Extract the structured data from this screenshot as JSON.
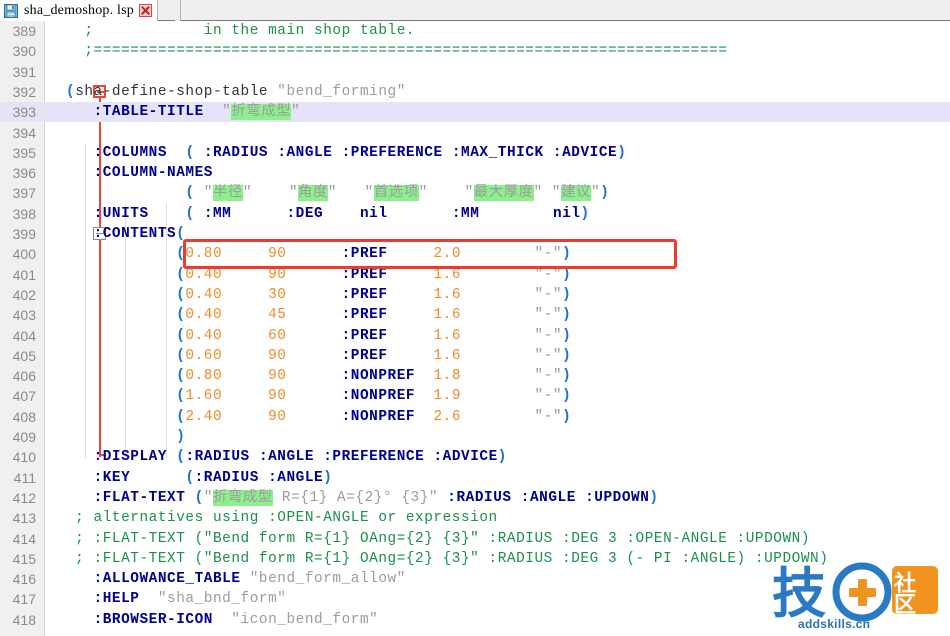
{
  "window": {
    "tab": {
      "title": "sha_demoshop. lsp",
      "save_icon": "floppy-save-icon",
      "close_icon": "close-icon"
    }
  },
  "editor": {
    "first_line_number": 389,
    "colors": {
      "keyword": "#00008f",
      "paren": "#1f6fd0",
      "number": "#f08b2a",
      "string": "#9c9c9c",
      "comment": "#1a8f4e",
      "current_line_bg": "#e6e3f7",
      "selection_bg": "#8cf08c",
      "annotation": "#ee3b2b",
      "gutter_bg": "#f0f0f0"
    },
    "lines": [
      {
        "n": 389,
        "text": "  ;            in the main shop table."
      },
      {
        "n": 390,
        "text": "  ;====================================================================="
      },
      {
        "n": 391,
        "text": ""
      },
      {
        "n": 392,
        "text": "(sha-define-shop-table \"bend_forming\""
      },
      {
        "n": 393,
        "text": "   :TABLE-TITLE  \"折弯成型\""
      },
      {
        "n": 394,
        "text": ""
      },
      {
        "n": 395,
        "text": "   :COLUMNS  ( :RADIUS :ANGLE :PREFERENCE :MAX_THICK :ADVICE)"
      },
      {
        "n": 396,
        "text": "   :COLUMN-NAMES"
      },
      {
        "n": 397,
        "text": "             ( \"半径\"    \"角度\"   \"首选项\"    \"最大厚度\" \"建议\")"
      },
      {
        "n": 398,
        "text": "   :UNITS    ( :MM      :DEG    nil       :MM        nil)"
      },
      {
        "n": 399,
        "text": "   :CONTENTS("
      },
      {
        "n": 400,
        "text": "            (0.80     90      :PREF     2.0        \"-\")"
      },
      {
        "n": 401,
        "text": "            (0.40     90      :PREF     1.6        \"-\")"
      },
      {
        "n": 402,
        "text": "            (0.40     30      :PREF     1.6        \"-\")"
      },
      {
        "n": 403,
        "text": "            (0.40     45      :PREF     1.6        \"-\")"
      },
      {
        "n": 404,
        "text": "            (0.40     60      :PREF     1.6        \"-\")"
      },
      {
        "n": 405,
        "text": "            (0.60     90      :PREF     1.6        \"-\")"
      },
      {
        "n": 406,
        "text": "            (0.80     90      :NONPREF  1.8        \"-\")"
      },
      {
        "n": 407,
        "text": "            (1.60     90      :NONPREF  1.9        \"-\")"
      },
      {
        "n": 408,
        "text": "            (2.40     90      :NONPREF  2.6        \"-\")"
      },
      {
        "n": 409,
        "text": "            )"
      },
      {
        "n": 410,
        "text": "   :DISPLAY (:RADIUS :ANGLE :PREFERENCE :ADVICE)"
      },
      {
        "n": 411,
        "text": "   :KEY      (:RADIUS :ANGLE)"
      },
      {
        "n": 412,
        "text": "   :FLAT-TEXT (\"折弯成型 R={1} A={2}° {3}\" :RADIUS :ANGLE :UPDOWN)"
      },
      {
        "n": 413,
        "text": " ; alternatives using :OPEN-ANGLE or expression"
      },
      {
        "n": 414,
        "text": " ; :FLAT-TEXT (\"Bend form R={1} OAng={2} {3}\" :RADIUS :DEG 3 :OPEN-ANGLE :UPDOWN)"
      },
      {
        "n": 415,
        "text": " ; :FLAT-TEXT (\"Bend form R={1} OAng={2} {3}\" :RADIUS :DEG 3 (- PI :ANGLE) :UPDOWN)"
      },
      {
        "n": 416,
        "text": "   :ALLOWANCE_TABLE \"bend_form_allow\""
      },
      {
        "n": 417,
        "text": "   :HELP  \"sha_bnd_form\""
      },
      {
        "n": 418,
        "text": "   :BROWSER-ICON  \"icon_bend_form\""
      }
    ],
    "table": {
      "columns": [
        ":RADIUS",
        ":ANGLE",
        ":PREFERENCE",
        ":MAX_THICK",
        ":ADVICE"
      ],
      "column_names": [
        "半径",
        "角度",
        "首选项",
        "最大厚度",
        "建议"
      ],
      "units": [
        ":MM",
        ":DEG",
        "nil",
        ":MM",
        "nil"
      ],
      "title": "折弯成型",
      "name": "bend_forming",
      "rows": [
        [
          "0.80",
          "90",
          ":PREF",
          "2.0",
          "-"
        ],
        [
          "0.40",
          "90",
          ":PREF",
          "1.6",
          "-"
        ],
        [
          "0.40",
          "30",
          ":PREF",
          "1.6",
          "-"
        ],
        [
          "0.40",
          "45",
          ":PREF",
          "1.6",
          "-"
        ],
        [
          "0.40",
          "60",
          ":PREF",
          "1.6",
          "-"
        ],
        [
          "0.60",
          "90",
          ":PREF",
          "1.6",
          "-"
        ],
        [
          "0.80",
          "90",
          ":NONPREF",
          "1.8",
          "-"
        ],
        [
          "1.60",
          "90",
          ":NONPREF",
          "1.9",
          "-"
        ],
        [
          "2.40",
          "90",
          ":NONPREF",
          "2.6",
          "-"
        ]
      ],
      "display": [
        ":RADIUS",
        ":ANGLE",
        ":PREFERENCE",
        ":ADVICE"
      ],
      "key": [
        ":RADIUS",
        ":ANGLE"
      ],
      "allowance_table": "bend_form_allow",
      "help": "sha_bnd_form",
      "browser_icon": "icon_bend_form"
    },
    "annotation": {
      "target_line": 400,
      "shape": "rectangle"
    }
  },
  "watermark": {
    "logo_text": "技",
    "logo_text2": "社区",
    "plus": "+",
    "url": "addskills.cn"
  }
}
